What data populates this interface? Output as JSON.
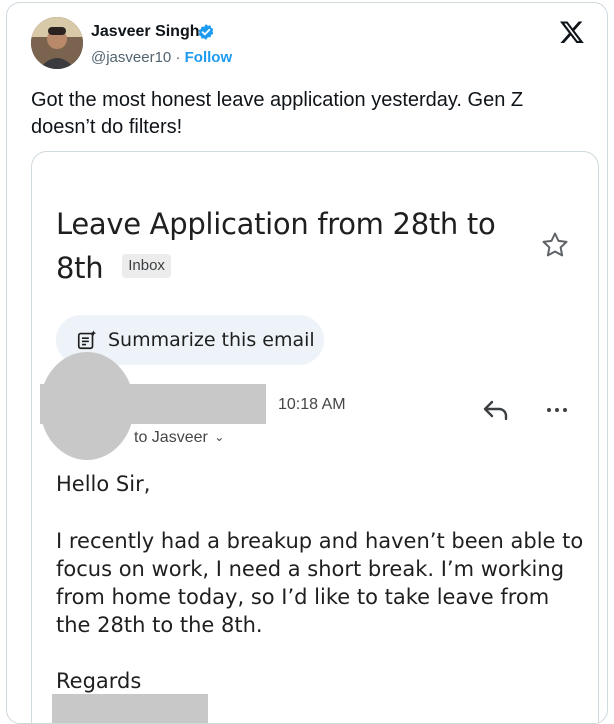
{
  "tweet": {
    "author_name": "Jasveer Singh",
    "handle": "@jasveer10",
    "separator": "·",
    "follow_label": "Follow",
    "text": "Got the most honest leave application yesterday. Gen Z doesn’t do filters!"
  },
  "email": {
    "subject": "Leave Application from 28th to 8th",
    "label_chip": "Inbox",
    "summarize_label": "Summarize this email",
    "time": "10:18 AM",
    "to_line": "to Jasveer",
    "greeting": "Hello Sir,",
    "body": "I recently had a breakup and haven’t been able to focus on work, I need a short break. I’m working from home today, so I’d like to take leave from the 28th to the 8th.",
    "signoff": "Regards"
  },
  "icons": {
    "verified": "verified-badge-icon",
    "platform": "x-logo-icon",
    "star": "star-icon",
    "summarize": "summarize-icon",
    "reply": "reply-icon",
    "more": "more-options-icon"
  },
  "colors": {
    "accent": "#1d9bf0",
    "redaction": "#c8c8c8",
    "summarize_bg": "#edf3f8"
  }
}
